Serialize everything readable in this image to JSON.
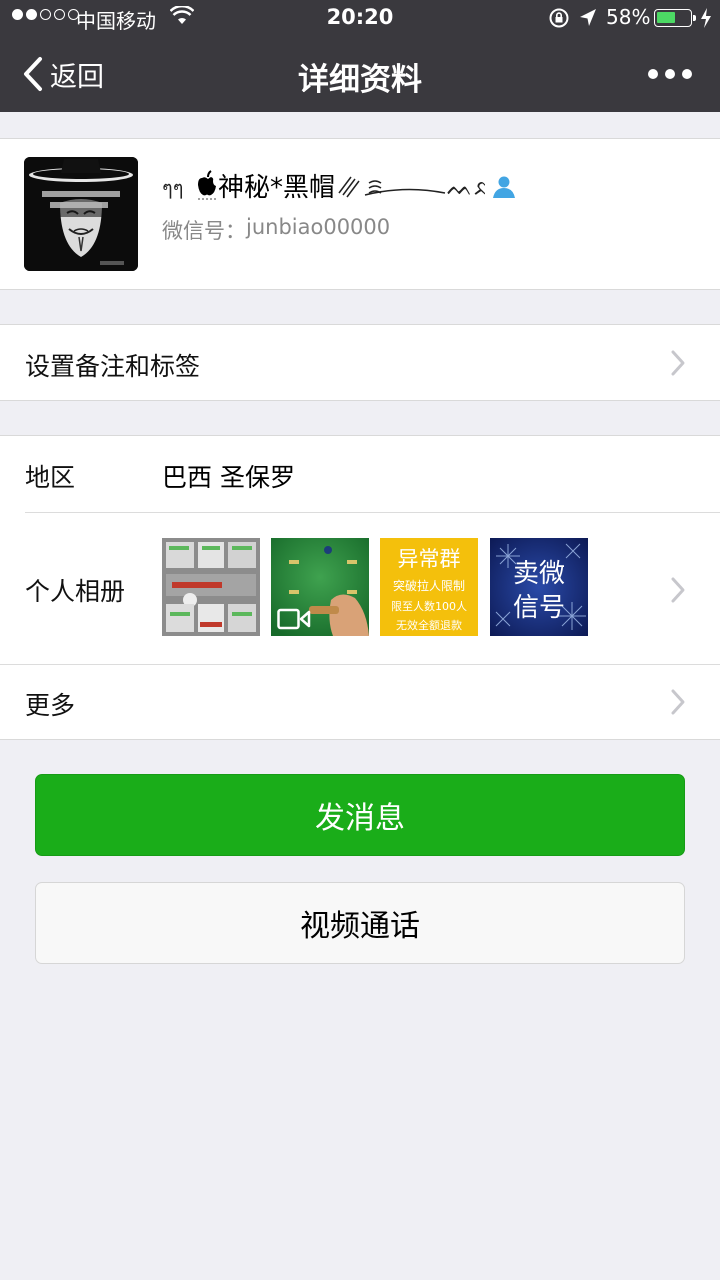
{
  "status_bar": {
    "carrier": "中国移动",
    "time": "20:20",
    "battery_percent": "58%",
    "battery_level": 0.58
  },
  "nav": {
    "back_label": "返回",
    "title": "详细资料",
    "more_icon": "more-dots-icon"
  },
  "profile": {
    "nickname": "神秘*黑帽",
    "wechat_id_label": "微信号：",
    "wechat_id": "junbiao00000"
  },
  "remark": {
    "label": "设置备注和标签"
  },
  "region": {
    "label": "地区",
    "value": "巴西 圣保罗"
  },
  "album": {
    "label": "个人相册",
    "thumbnails": [
      {
        "type": "image"
      },
      {
        "type": "video"
      },
      {
        "type": "image",
        "lines": [
          "异常群",
          "突破拉人限制",
          "限至人数100人",
          "无效全额退款"
        ]
      },
      {
        "type": "image",
        "lines": [
          "卖微",
          "信号"
        ]
      }
    ]
  },
  "more": {
    "label": "更多"
  },
  "actions": {
    "send_message": "发消息",
    "video_call": "视频通话"
  },
  "colors": {
    "nav_bg": "#3a393e",
    "primary_green": "#1aad19",
    "page_bg": "#efeff4"
  }
}
